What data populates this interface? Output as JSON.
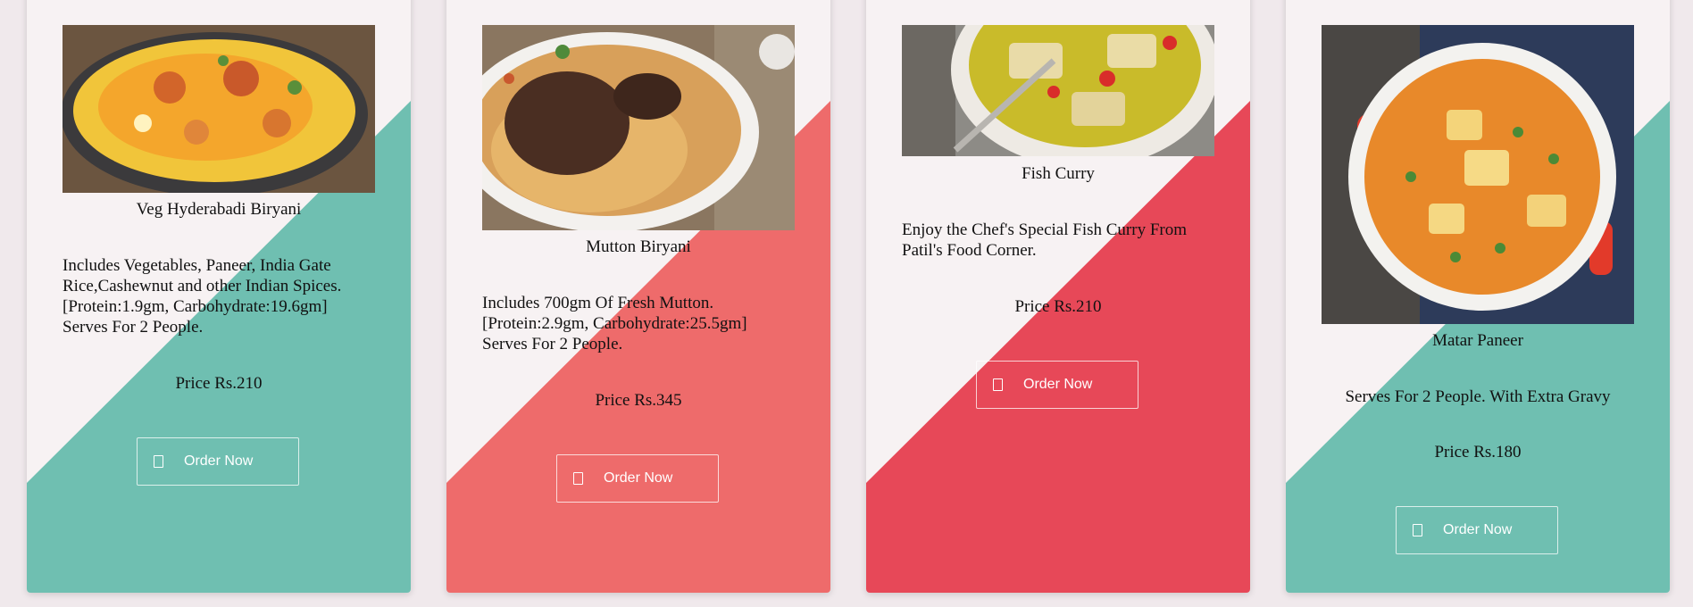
{
  "colors": {
    "card_bg": "#f7f2f3",
    "teal": "#6fbfb1",
    "salmon": "#ee6b6b",
    "red": "#e74858",
    "page_bg": "#f0e9ec"
  },
  "cards": [
    {
      "title": "Veg Hyderabadi Biryani",
      "description": "Includes Vegetables, Paneer, India Gate Rice,Cashewnut and other Indian Spices. [Protein:1.9gm, Carbohydrate:19.6gm] Serves For 2 People.",
      "price": "Price Rs.210",
      "button_label": "Order Now",
      "accent": "#6fbfb1",
      "image_icon": "biryani-plate-photo"
    },
    {
      "title": "Mutton Biryani",
      "description": "Includes 700gm Of Fresh Mutton. [Protein:2.9gm, Carbohydrate:25.5gm] Serves For 2 People.",
      "price": "Price Rs.345",
      "button_label": "Order Now",
      "accent": "#ee6b6b",
      "image_icon": "mutton-biryani-photo"
    },
    {
      "title": "Fish Curry",
      "description": "Enjoy the Chef's Special Fish Curry From Patil's Food Corner.",
      "price": "Price Rs.210",
      "button_label": "Order Now",
      "accent": "#e74858",
      "image_icon": "fish-curry-photo"
    },
    {
      "title": "Matar Paneer",
      "description": "Serves For 2 People. With Extra Gravy",
      "price": "Price Rs.180",
      "button_label": "Order Now",
      "accent": "#6fbfb1",
      "image_icon": "matar-paneer-photo"
    }
  ]
}
